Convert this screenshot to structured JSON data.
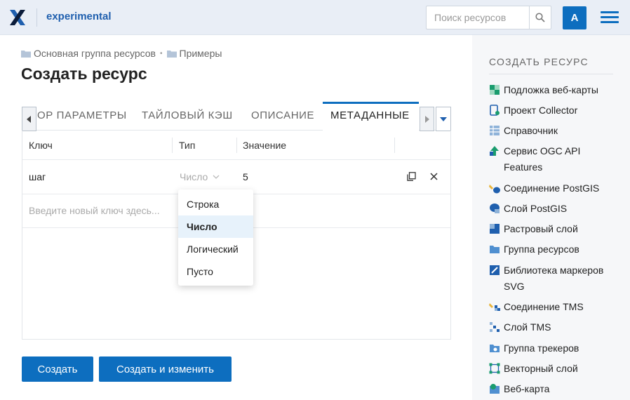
{
  "header": {
    "app_title": "experimental",
    "search_placeholder": "Поиск ресурсов",
    "avatar_letter": "A",
    "accent_color": "#0d6ebf"
  },
  "breadcrumb": [
    {
      "label": "Основная группа ресурсов",
      "icon": "folder-icon"
    },
    {
      "label": "Примеры",
      "icon": "folder-icon"
    }
  ],
  "page_title": "Создать ресурс",
  "tabs": {
    "items": [
      {
        "label": "ОР ПАРАМЕТРЫ",
        "active": false
      },
      {
        "label": "ТАЙЛОВЫЙ КЭШ",
        "active": false
      },
      {
        "label": "ОПИСАНИЕ",
        "active": false
      },
      {
        "label": "МЕТАДАННЫЕ",
        "active": true
      }
    ]
  },
  "metadata_table": {
    "headers": {
      "key": "Ключ",
      "type": "Тип",
      "value": "Значение"
    },
    "rows": [
      {
        "key": "шаг",
        "type": "Число",
        "value": "5"
      }
    ],
    "new_key_placeholder": "Введите новый ключ здесь..."
  },
  "type_dropdown": {
    "options": [
      "Строка",
      "Число",
      "Логический",
      "Пусто"
    ],
    "selected": "Число"
  },
  "actions": {
    "create": "Создать",
    "create_and_edit": "Создать и изменить"
  },
  "sidebar": {
    "title": "СОЗДАТЬ РЕСУРС",
    "items": [
      {
        "label": "Подложка веб-карты",
        "icon": "basemap-icon"
      },
      {
        "label": "Проект Collector",
        "icon": "collector-project-icon"
      },
      {
        "label": "Справочник",
        "icon": "lookup-table-icon"
      },
      {
        "label": "Сервис OGC API Features",
        "icon": "ogc-service-icon"
      },
      {
        "label": "Соединение PostGIS",
        "icon": "postgis-connection-icon"
      },
      {
        "label": "Слой PostGIS",
        "icon": "postgis-layer-icon"
      },
      {
        "label": "Растровый слой",
        "icon": "raster-layer-icon"
      },
      {
        "label": "Группа ресурсов",
        "icon": "resource-group-icon"
      },
      {
        "label": "Библиотека маркеров SVG",
        "icon": "svg-library-icon"
      },
      {
        "label": "Соединение TMS",
        "icon": "tms-connection-icon"
      },
      {
        "label": "Слой TMS",
        "icon": "tms-layer-icon"
      },
      {
        "label": "Группа трекеров",
        "icon": "tracker-group-icon"
      },
      {
        "label": "Векторный слой",
        "icon": "vector-layer-icon"
      },
      {
        "label": "Веб-карта",
        "icon": "webmap-icon"
      }
    ]
  }
}
